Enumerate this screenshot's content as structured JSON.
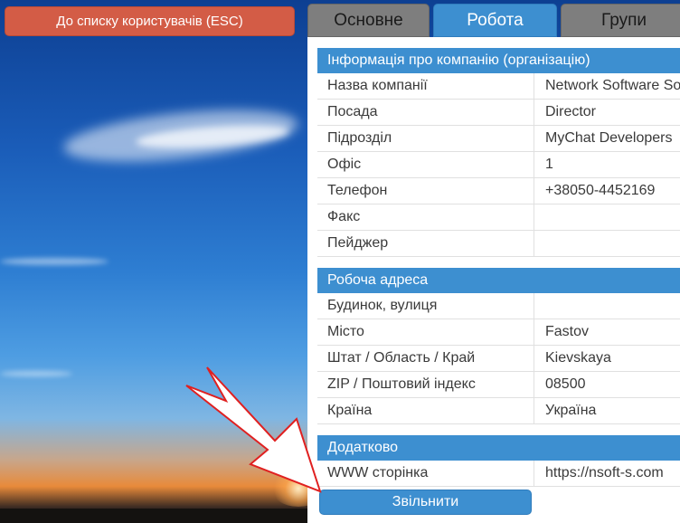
{
  "back_button": {
    "label": "До списку користувачів (ESC)"
  },
  "tabs": [
    {
      "label": "Основне",
      "active": false
    },
    {
      "label": "Робота",
      "active": true
    },
    {
      "label": "Групи",
      "active": false
    }
  ],
  "sections": {
    "company": {
      "title": "Інформація про компанію (організацію)",
      "rows": [
        {
          "label": "Назва компанії",
          "value": "Network Software So"
        },
        {
          "label": "Посада",
          "value": "Director"
        },
        {
          "label": "Підрозділ",
          "value": "MyChat Developers"
        },
        {
          "label": "Офіс",
          "value": "1"
        },
        {
          "label": "Телефон",
          "value": "+38050-4452169"
        },
        {
          "label": "Факс",
          "value": ""
        },
        {
          "label": "Пейджер",
          "value": ""
        }
      ]
    },
    "address": {
      "title": "Робоча адреса",
      "rows": [
        {
          "label": "Будинок, вулиця",
          "value": ""
        },
        {
          "label": "Місто",
          "value": "Fastov"
        },
        {
          "label": "Штат / Область / Край",
          "value": "Kievskaya"
        },
        {
          "label": "ZIP / Поштовий індекс",
          "value": "08500"
        },
        {
          "label": "Країна",
          "value": "Україна"
        }
      ]
    },
    "extra": {
      "title": "Додатково",
      "rows": [
        {
          "label": "WWW сторінка",
          "value": "https://nsoft-s.com"
        }
      ]
    }
  },
  "fire_button": {
    "label": "Звільнити"
  },
  "colors": {
    "accent": "#3d8fd0",
    "back_button": "#d35c46",
    "inactive_tab": "#7e7e7e",
    "annotation_arrow": "#e02020"
  }
}
